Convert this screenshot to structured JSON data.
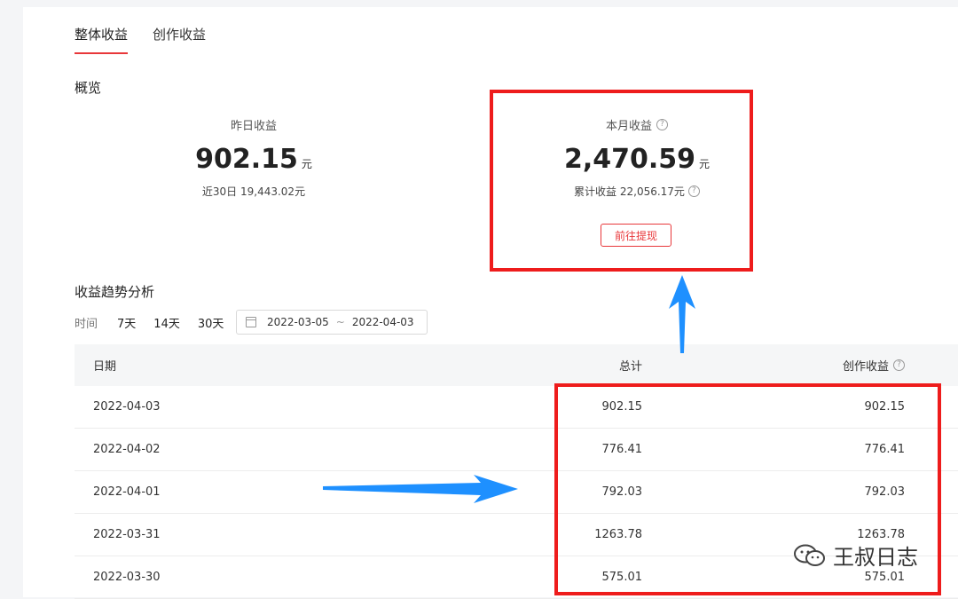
{
  "tabs": [
    {
      "label": "整体收益",
      "active": true
    },
    {
      "label": "创作收益",
      "active": false
    }
  ],
  "overview": {
    "title": "概览",
    "yesterday": {
      "label": "昨日收益",
      "value": "902.15",
      "unit": "元",
      "sub": "近30日 19,443.02元"
    },
    "month": {
      "label": "本月收益",
      "value": "2,470.59",
      "unit": "元",
      "sub": "累计收益 22,056.17元"
    },
    "withdraw_label": "前往提现"
  },
  "trend": {
    "title": "收益趋势分析",
    "filter_label": "时间",
    "options": [
      "7天",
      "14天",
      "30天"
    ],
    "date_start": "2022-03-05",
    "date_sep": "~",
    "date_end": "2022-04-03"
  },
  "table": {
    "headers": {
      "date": "日期",
      "total": "总计",
      "creation": "创作收益"
    },
    "rows": [
      {
        "date": "2022-04-03",
        "total": "902.15",
        "creation": "902.15"
      },
      {
        "date": "2022-04-02",
        "total": "776.41",
        "creation": "776.41"
      },
      {
        "date": "2022-04-01",
        "total": "792.03",
        "creation": "792.03"
      },
      {
        "date": "2022-03-31",
        "total": "1263.78",
        "creation": "1263.78"
      },
      {
        "date": "2022-03-30",
        "total": "575.01",
        "creation": "575.01"
      }
    ]
  },
  "watermark": {
    "text": "王叔日志",
    "icon": "wechat-icon"
  },
  "colors": {
    "accent_red": "#e8373a",
    "annotation_red": "#ee1c1c",
    "annotation_blue": "#1e90ff"
  }
}
